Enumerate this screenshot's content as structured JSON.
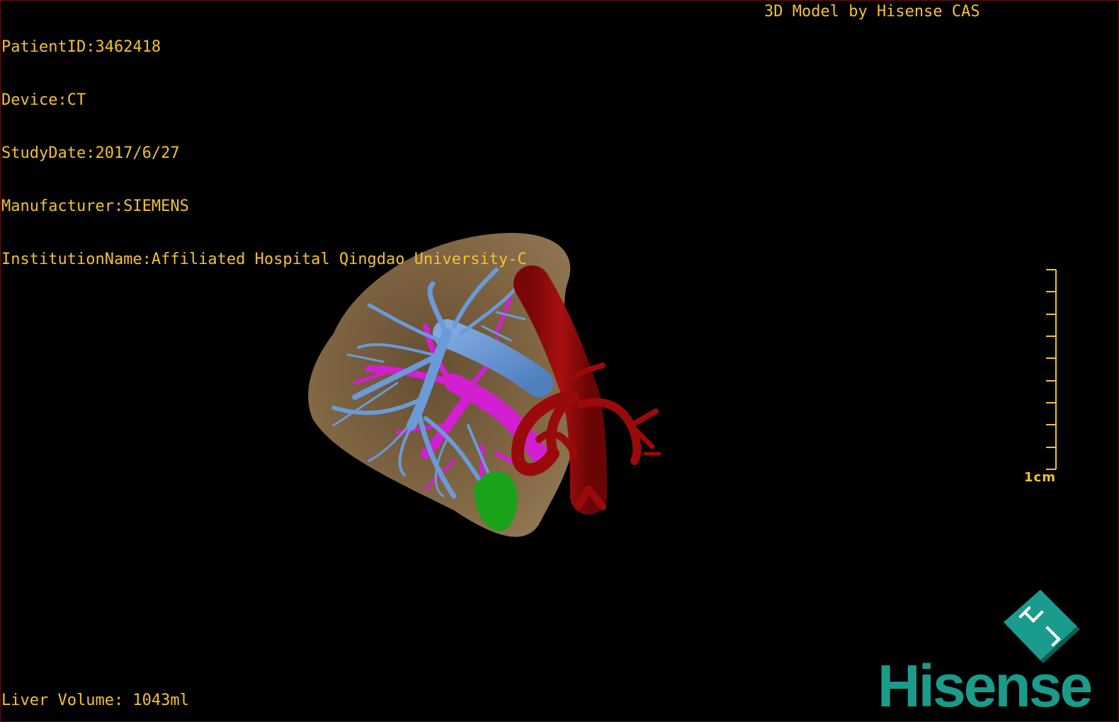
{
  "viewer": {
    "patient_id": "PatientID:3462418",
    "device": "Device:CT",
    "study_date": "StudyDate:2017/6/27",
    "manufacturer": "Manufacturer:SIEMENS",
    "institution": "InstitutionName:Affiliated Hospital Qingdao University-C",
    "credit": "3D Model by Hisense CAS",
    "liver_volume": "Liver Volume: 1043ml",
    "scale_label": "1cm"
  },
  "brand": {
    "name": "Hisense",
    "color": "#1a9b8c"
  },
  "colors": {
    "overlay_text": "#f2c230",
    "liver": "#8a6d48",
    "hepatic_vein": "#6a9ad8",
    "portal_vein": "#d21fd2",
    "artery": "#9a0a0a",
    "gallbladder": "#1aa31a",
    "background": "#000000"
  }
}
